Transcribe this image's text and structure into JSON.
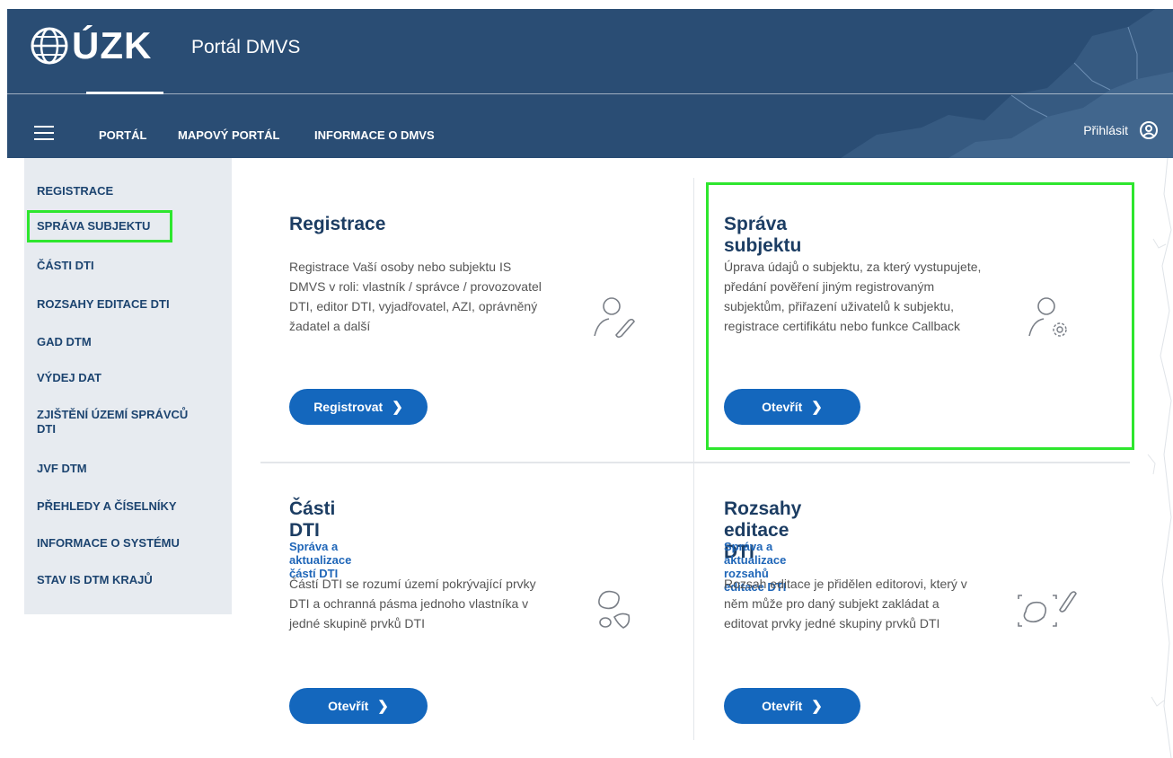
{
  "header": {
    "logo_text": "ÚZK",
    "app_title": "Portál DMVS",
    "nav": [
      "PORTÁL",
      "MAPOVÝ PORTÁL",
      "INFORMACE O DMVS"
    ],
    "active_nav": "PORTÁL",
    "login_label": "Přihlásit",
    "colors": {
      "header_bg": "#2a4d74",
      "accent": "#1467bd",
      "highlight": "#2ee62e"
    }
  },
  "sidebar": {
    "items": [
      {
        "label": "REGISTRACE"
      },
      {
        "label": "SPRÁVA SUBJEKTU"
      },
      {
        "label": "ČÁSTI DTI"
      },
      {
        "label": "ROZSAHY EDITACE DTI"
      },
      {
        "label": "GAD DTM"
      },
      {
        "label": "VÝDEJ DAT"
      },
      {
        "label": "ZJIŠTĚNÍ ÚZEMÍ SPRÁVCŮ DTI"
      },
      {
        "label": "JVF DTM"
      },
      {
        "label": "PŘEHLEDY A ČÍSELNÍKY"
      },
      {
        "label": "INFORMACE O SYSTÉMU"
      },
      {
        "label": "STAV IS DTM KRAJŮ"
      }
    ]
  },
  "cards": [
    {
      "title": "Registrace",
      "text": "Registrace Vaší osoby nebo subjektu IS DMVS v roli: vlastník / správce / provozovatel DTI, editor DTI, vyjadřovatel, AZI, oprávněný žadatel a další",
      "button": "Registrovat",
      "icon": "user-edit-icon"
    },
    {
      "title": "Správa subjektu",
      "text": "Úprava údajů o subjektu, za který vystupujete, předání pověření jiným registrovaným subjektům, přiřazení uživatelů k subjektu, registrace certifikátu nebo funkce Callback",
      "button": "Otevřít",
      "icon": "user-settings-icon"
    },
    {
      "title": "Části DTI",
      "subtitle": "Správa a aktualizace částí DTI",
      "text": "Částí DTI se rozumí území pokrývající prvky DTI a ochranná pásma jednoho vlastníka v jedné skupině prvků DTI",
      "button": "Otevřít",
      "icon": "areas-icon"
    },
    {
      "title": "Rozsahy editace DTI",
      "subtitle": "Správa a aktualizace rozsahů editace DTI",
      "text": "Rozsah editace je přidělen editorovi, který v něm může pro daný subjekt zakládat a editovat prvky jedné skupiny prvků DTI",
      "button": "Otevřít",
      "icon": "area-edit-icon"
    }
  ]
}
